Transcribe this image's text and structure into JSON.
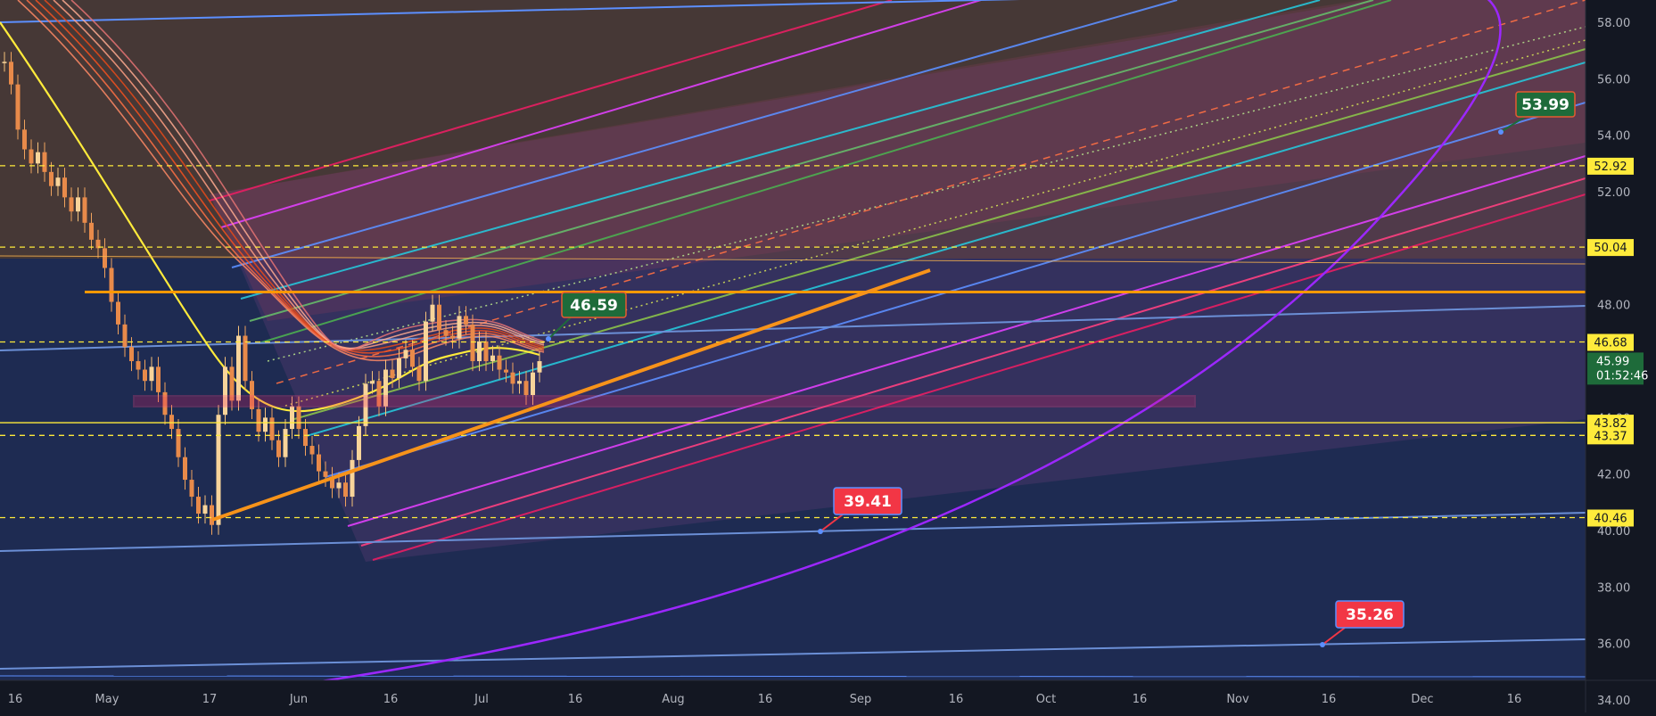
{
  "chart_data": {
    "type": "candlestick",
    "x_ticks": [
      "16",
      "May",
      "17",
      "Jun",
      "16",
      "Jul",
      "16",
      "Aug",
      "16",
      "Sep",
      "16",
      "Oct",
      "16",
      "Nov",
      "16",
      "Dec",
      "16"
    ],
    "y_ticks": [
      "58.00",
      "56.00",
      "54.00",
      "52.00",
      "50.00",
      "48.00",
      "46.00",
      "44.00",
      "42.00",
      "40.00",
      "38.00",
      "36.00",
      "34.00"
    ],
    "ylim": [
      34,
      58.5
    ],
    "price_labels": [
      {
        "value": 52.92,
        "text": "52.92",
        "style": "yellow"
      },
      {
        "value": 50.04,
        "text": "50.04",
        "style": "yellow"
      },
      {
        "value": 46.68,
        "text": "46.68",
        "style": "yellow"
      },
      {
        "value": 43.82,
        "text": "43.82",
        "style": "yellow"
      },
      {
        "value": 43.37,
        "text": "43.37",
        "style": "yellow"
      },
      {
        "value": 40.46,
        "text": "40.46",
        "style": "yellow"
      }
    ],
    "last_price": {
      "value": 45.99,
      "text": "45.99",
      "countdown": "01:52:46"
    },
    "callouts": [
      {
        "text": "46.59",
        "color": "#1e6b3a"
      },
      {
        "text": "53.99",
        "color": "#1e6b3a"
      },
      {
        "text": "39.41",
        "color": "#f23645"
      },
      {
        "text": "35.26",
        "color": "#f23645"
      }
    ],
    "horizontal_levels": [
      {
        "value": 48.45,
        "color": "#ff9800",
        "style": "solid"
      },
      {
        "value": 43.82,
        "color": "#ffeb3b",
        "style": "solid"
      },
      {
        "value": 52.92,
        "color": "#ffeb3b",
        "style": "dashed"
      },
      {
        "value": 50.04,
        "color": "#ffeb3b",
        "style": "dashed"
      },
      {
        "value": 46.68,
        "color": "#ffeb3b",
        "style": "dashed"
      },
      {
        "value": 43.37,
        "color": "#ffeb3b",
        "style": "dashed"
      },
      {
        "value": 40.46,
        "color": "#ffeb3b",
        "style": "dashed"
      }
    ],
    "candles_close": [
      56.6,
      55.8,
      54.2,
      53.5,
      53.0,
      53.4,
      52.7,
      52.2,
      52.5,
      51.8,
      51.3,
      51.8,
      50.9,
      50.3,
      50.0,
      49.3,
      48.1,
      47.3,
      46.5,
      46.0,
      45.7,
      45.3,
      45.8,
      44.9,
      44.1,
      43.6,
      42.6,
      41.8,
      41.2,
      40.6,
      40.9,
      40.2,
      44.1,
      45.8,
      44.6,
      46.9,
      45.3,
      44.3,
      43.5,
      44.0,
      43.2,
      42.6,
      43.6,
      44.4,
      43.6,
      43.0,
      42.7,
      42.1,
      41.9,
      41.5,
      41.7,
      41.2,
      42.5,
      43.7,
      45.2,
      45.3,
      44.4,
      45.7,
      45.4,
      46.1,
      46.4,
      45.8,
      45.3,
      47.4,
      48.0,
      47.1,
      46.9,
      46.8,
      47.6,
      47.3,
      46.0,
      46.7,
      46.0,
      46.2,
      45.7,
      45.6,
      45.2,
      45.3,
      44.8,
      45.6,
      46.0
    ],
    "colors": {
      "up": "#26a69a",
      "down": "#ef5350",
      "candle": "#f0b27a",
      "background": "#131722",
      "plot_bg": "#1e2b52",
      "upper_zone": "#4a3a33",
      "lasso_arc": "#9c27ff",
      "trend": "#f7931a"
    }
  }
}
